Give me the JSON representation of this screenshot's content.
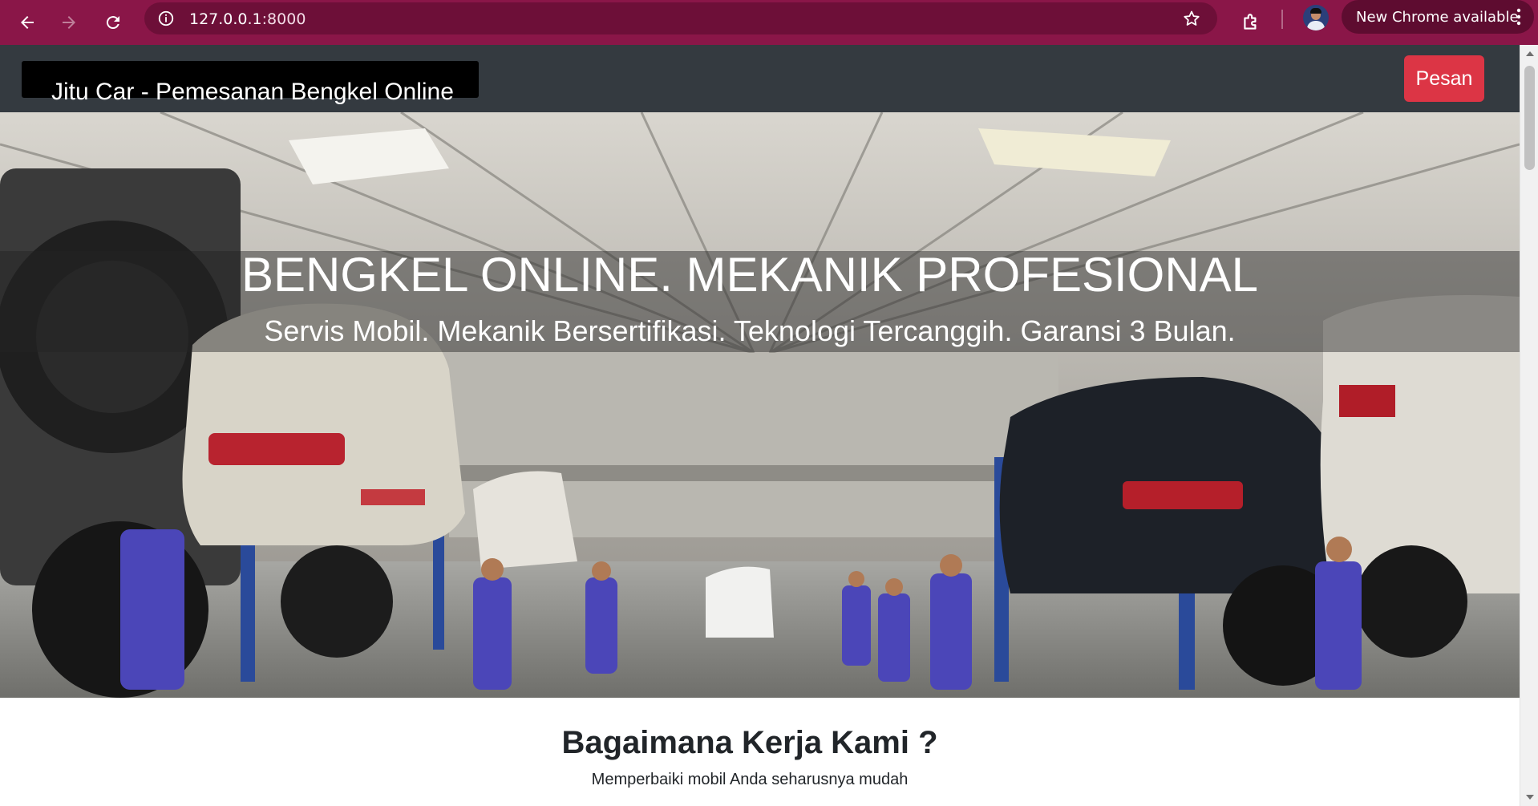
{
  "browser": {
    "url_host": "127.0.0.1",
    "url_port": ":8000",
    "update_label": "New Chrome available"
  },
  "header": {
    "brand": "Jitu Car - Pemesanan Bengkel Online",
    "order_button": "Pesan"
  },
  "hero": {
    "title": "BENGKEL ONLINE. MEKANIK PROFESIONAL",
    "subtitle": "Servis Mobil. Mekanik Bersertifikasi. Teknologi Tercanggih. Garansi 3 Bulan."
  },
  "how_it_works": {
    "title": "Bagaimana Kerja Kami ?",
    "subtitle": "Memperbaiki mobil Anda seharusnya mudah"
  },
  "colors": {
    "chrome_frame": "#8a1648",
    "header_bg": "#343a40",
    "order_button": "#dc3545"
  },
  "icons": [
    "back-arrow-icon",
    "forward-arrow-icon",
    "reload-icon",
    "site-info-icon",
    "bookmark-star-icon",
    "extensions-icon",
    "more-vert-icon"
  ]
}
